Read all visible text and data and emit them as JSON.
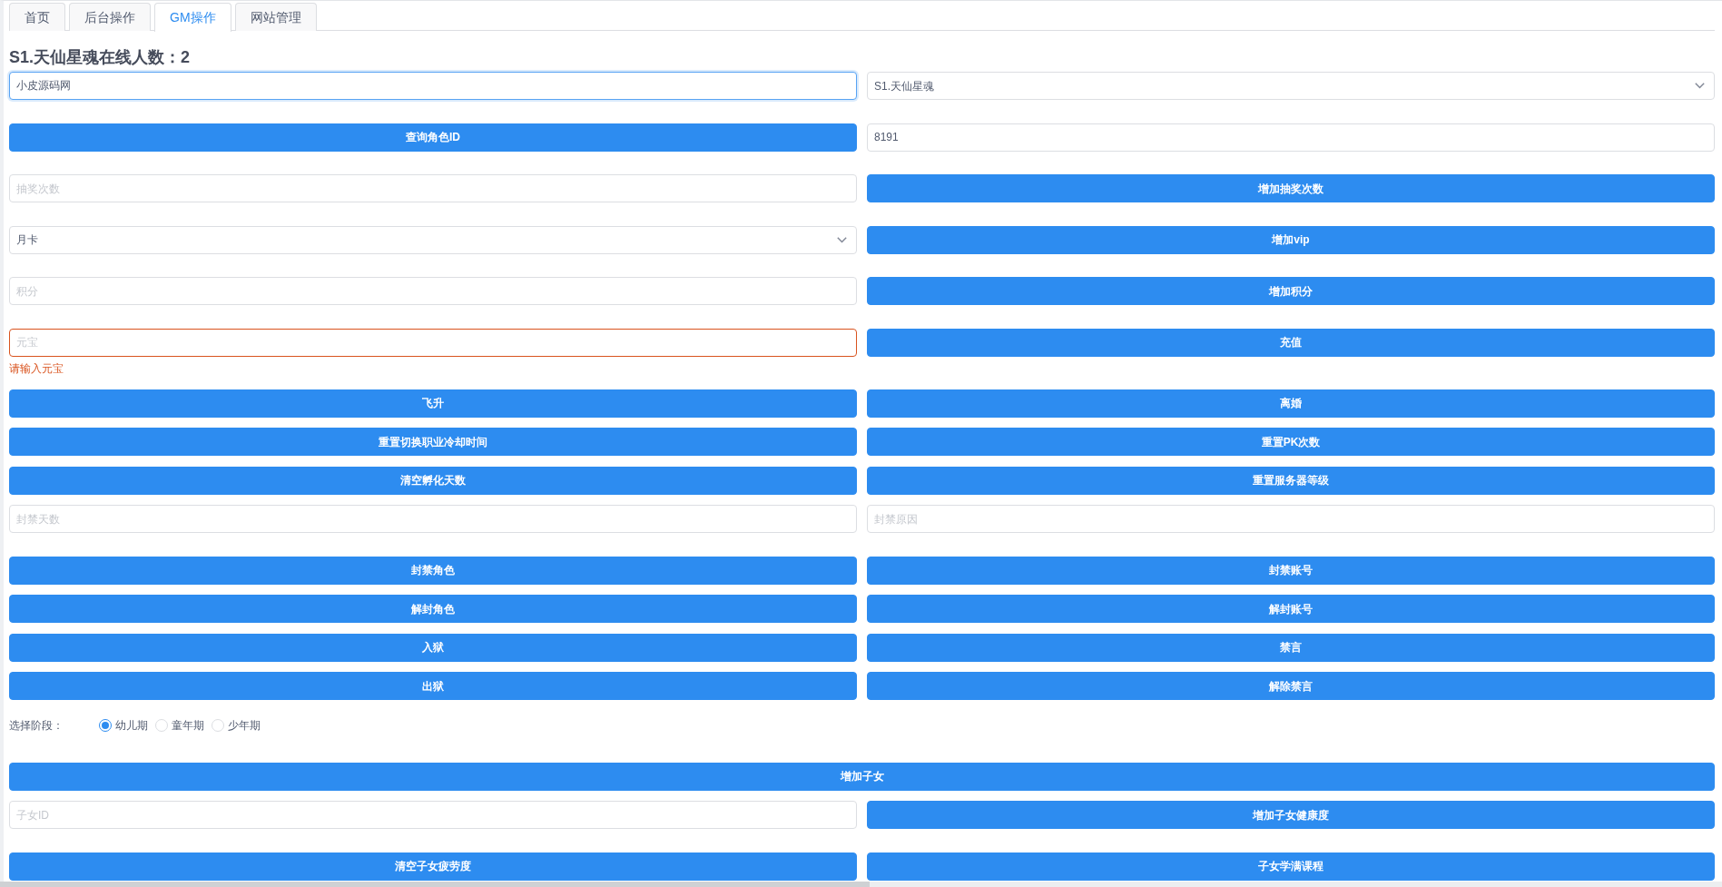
{
  "tabs": [
    {
      "label": "首页",
      "selected": false
    },
    {
      "label": "后台操作",
      "selected": false
    },
    {
      "label": "GM操作",
      "selected": true
    },
    {
      "label": "网站管理",
      "selected": false
    }
  ],
  "heading": "S1.天仙星魂在线人数：2",
  "form_rows": [
    {
      "items": [
        {
          "kind": "input",
          "value": "小皮源码网",
          "focused": true,
          "invalid": false
        },
        {
          "kind": "select",
          "value": "S1.天仙星魂",
          "focused": false,
          "invalid": false
        }
      ]
    },
    {
      "items": [
        {
          "kind": "button",
          "label": "查询角色ID"
        },
        {
          "kind": "input",
          "value": "8191",
          "focused": false,
          "invalid": false
        }
      ]
    },
    {
      "items": [
        {
          "kind": "input",
          "placeholder": "抽奖次数",
          "focused": false,
          "invalid": false
        },
        {
          "kind": "button",
          "label": "增加抽奖次数"
        }
      ]
    },
    {
      "items": [
        {
          "kind": "select",
          "value": "月卡",
          "focused": false,
          "invalid": false
        },
        {
          "kind": "button",
          "label": "增加vip"
        }
      ]
    },
    {
      "items": [
        {
          "kind": "input",
          "placeholder": "积分",
          "focused": false,
          "invalid": false
        },
        {
          "kind": "button",
          "label": "增加积分"
        }
      ]
    },
    {
      "items": [
        {
          "kind": "input",
          "placeholder": "元宝",
          "focused": false,
          "invalid": true,
          "error": "请输入元宝"
        },
        {
          "kind": "button",
          "label": "充值"
        }
      ]
    },
    {
      "items": [
        {
          "kind": "button",
          "label": "飞升"
        },
        {
          "kind": "button",
          "label": "离婚"
        }
      ]
    },
    {
      "items": [
        {
          "kind": "button",
          "label": "重置切换职业冷却时间"
        },
        {
          "kind": "button",
          "label": "重置PK次数"
        }
      ]
    },
    {
      "items": [
        {
          "kind": "button",
          "label": "清空孵化天数"
        },
        {
          "kind": "button",
          "label": "重置服务器等级"
        }
      ]
    },
    {
      "items": [
        {
          "kind": "input",
          "placeholder": "封禁天数",
          "focused": false,
          "invalid": false
        },
        {
          "kind": "input",
          "placeholder": "封禁原因",
          "focused": false,
          "invalid": false
        }
      ]
    },
    {
      "items": [
        {
          "kind": "button",
          "label": "封禁角色"
        },
        {
          "kind": "button",
          "label": "封禁账号"
        }
      ]
    },
    {
      "items": [
        {
          "kind": "button",
          "label": "解封角色"
        },
        {
          "kind": "button",
          "label": "解封账号"
        }
      ]
    },
    {
      "items": [
        {
          "kind": "button",
          "label": "入狱"
        },
        {
          "kind": "button",
          "label": "禁言"
        }
      ]
    },
    {
      "items": [
        {
          "kind": "button",
          "label": "出狱"
        },
        {
          "kind": "button",
          "label": "解除禁言"
        }
      ]
    },
    {
      "items": [
        {
          "kind": "radio_group",
          "label": "选择阶段：",
          "options": [
            {
              "label": "幼儿期",
              "selected": true
            },
            {
              "label": "童年期",
              "selected": false
            },
            {
              "label": "少年期",
              "selected": false
            }
          ]
        }
      ]
    },
    {
      "items": [
        {
          "kind": "button",
          "label": "增加子女"
        }
      ]
    },
    {
      "items": [
        {
          "kind": "input",
          "placeholder": "子女ID",
          "focused": false,
          "invalid": false
        },
        {
          "kind": "button",
          "label": "增加子女健康度"
        }
      ]
    },
    {
      "items": [
        {
          "kind": "button",
          "label": "清空子女疲劳度"
        },
        {
          "kind": "button",
          "label": "子女学满课程"
        }
      ]
    }
  ]
}
